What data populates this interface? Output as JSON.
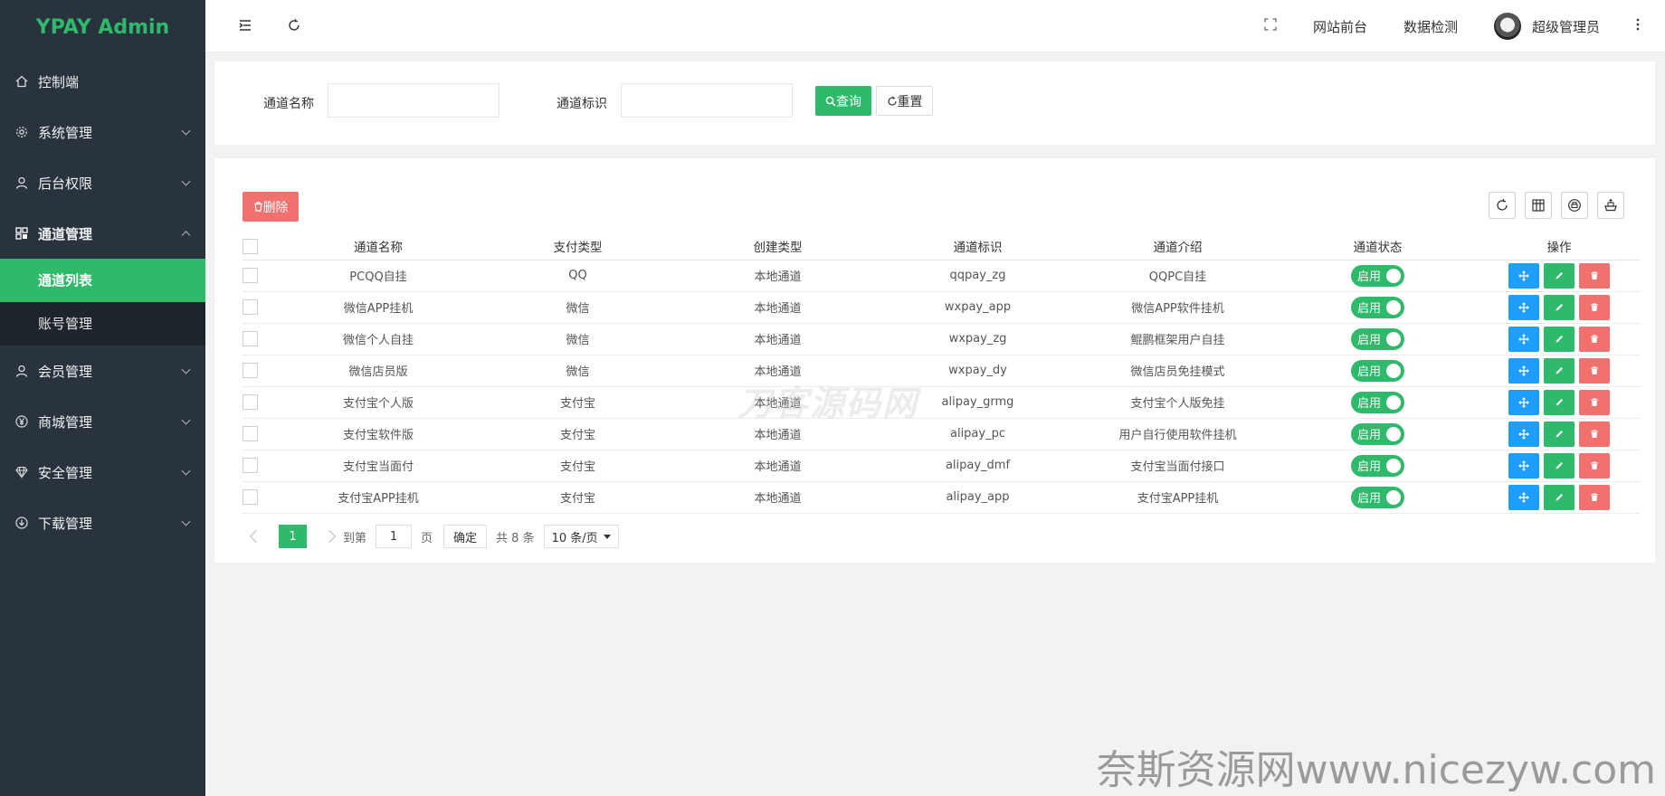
{
  "app": {
    "logo": "YPAY Admin"
  },
  "sidebar": {
    "items": [
      {
        "label": "控制端",
        "icon": "home-icon"
      },
      {
        "label": "系统管理",
        "icon": "gear-icon"
      },
      {
        "label": "后台权限",
        "icon": "user-icon"
      },
      {
        "label": "通道管理",
        "icon": "apps-icon",
        "expanded": true,
        "children": [
          {
            "label": "通道列表",
            "active": true
          },
          {
            "label": "账号管理"
          }
        ]
      },
      {
        "label": "会员管理",
        "icon": "user-icon"
      },
      {
        "label": "商城管理",
        "icon": "yen-icon"
      },
      {
        "label": "安全管理",
        "icon": "diamond-icon"
      },
      {
        "label": "下载管理",
        "icon": "download-icon"
      }
    ]
  },
  "header": {
    "links": [
      "网站前台",
      "数据检测"
    ],
    "user": "超级管理员"
  },
  "search": {
    "name_label": "通道名称",
    "id_label": "通道标识",
    "query_label": "查询",
    "reset_label": "重置"
  },
  "toolbar": {
    "delete_label": "删除"
  },
  "table": {
    "headers": [
      "通道名称",
      "支付类型",
      "创建类型",
      "通道标识",
      "通道介绍",
      "通道状态",
      "操作"
    ],
    "rows": [
      {
        "name": "PCQQ自挂",
        "pay": "QQ",
        "pay_color": "orange",
        "create": "本地通道",
        "ident": "qqpay_zg",
        "intro": "QQPC自挂",
        "status": "启用"
      },
      {
        "name": "微信APP挂机",
        "pay": "微信",
        "pay_color": "green",
        "create": "本地通道",
        "ident": "wxpay_app",
        "intro": "微信APP软件挂机",
        "status": "启用"
      },
      {
        "name": "微信个人自挂",
        "pay": "微信",
        "pay_color": "green",
        "create": "本地通道",
        "ident": "wxpay_zg",
        "intro": "鲲鹏框架用户自挂",
        "status": "启用"
      },
      {
        "name": "微信店员版",
        "pay": "微信",
        "pay_color": "green",
        "create": "本地通道",
        "ident": "wxpay_dy",
        "intro": "微信店员免挂模式",
        "status": "启用"
      },
      {
        "name": "支付宝个人版",
        "pay": "支付宝",
        "pay_color": "blue",
        "create": "本地通道",
        "ident": "alipay_grmg",
        "intro": "支付宝个人版免挂",
        "status": "启用"
      },
      {
        "name": "支付宝软件版",
        "pay": "支付宝",
        "pay_color": "blue",
        "create": "本地通道",
        "ident": "alipay_pc",
        "intro": "用户自行使用软件挂机",
        "status": "启用"
      },
      {
        "name": "支付宝当面付",
        "pay": "支付宝",
        "pay_color": "blue",
        "create": "本地通道",
        "ident": "alipay_dmf",
        "intro": "支付宝当面付接口",
        "status": "启用"
      },
      {
        "name": "支付宝APP挂机",
        "pay": "支付宝",
        "pay_color": "blue",
        "create": "本地通道",
        "ident": "alipay_app",
        "intro": "支付宝APP挂机",
        "status": "启用"
      }
    ]
  },
  "pager": {
    "current": "1",
    "goto_label": "到第",
    "page_input": "1",
    "page_label": "页",
    "confirm": "确定",
    "total": "共 8 条",
    "size": "10 条/页"
  },
  "watermarks": {
    "center": "刀客源码网",
    "bottom": "奈斯资源网www.nicezyw.com"
  },
  "colors": {
    "accent": "#2fb96a",
    "danger": "#f2706e",
    "info": "#1e9fff",
    "sidebar": "#28333e"
  }
}
